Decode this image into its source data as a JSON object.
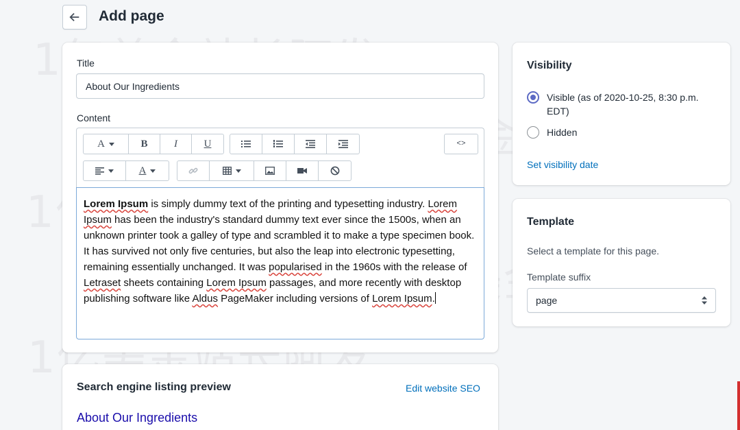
{
  "header": {
    "title": "Add page"
  },
  "main": {
    "title_label": "Title",
    "title_value": "About Our Ingredients",
    "content_label": "Content",
    "toolbar": {
      "font_btn": "A",
      "bold": "B",
      "italic": "I",
      "underline": "U",
      "html_btn": "<>",
      "color_btn": "A"
    },
    "editor": {
      "seg1_bold": "Lorem Ipsum",
      "seg2": " is simply dummy text of the printing and typesetting industry. ",
      "seg3": "Lorem Ipsum",
      "seg4": " has been the industry's standard dummy text ever since the 1500s, when an unknown printer took a galley of type and scrambled it to make a type specimen book. It has survived not only five centuries, but also the leap into electronic typesetting, remaining essentially unchanged. It was ",
      "seg5": "popularised",
      "seg6": " in the 1960s with the release of ",
      "seg7": "Letraset",
      "seg8": " sheets containing ",
      "seg9": "Lorem Ipsum",
      "seg10": " passages, and more recently with desktop publishing software like ",
      "seg11": "Aldus",
      "seg12": " PageMaker including versions of ",
      "seg13": "Lorem Ipsum",
      "seg14": "."
    }
  },
  "seo": {
    "heading": "Search engine listing preview",
    "edit_link": "Edit website SEO",
    "preview_title": "About Our Ingredients"
  },
  "visibility": {
    "heading": "Visibility",
    "visible_label": "Visible (as of 2020-10-25, 8:30 p.m. EDT)",
    "hidden_label": "Hidden",
    "set_date_link": "Set visibility date",
    "selected": "visible"
  },
  "template": {
    "heading": "Template",
    "description": "Select a template for this page.",
    "suffix_label": "Template suffix",
    "suffix_value": "page"
  },
  "watermark": {
    "text": "1亿美金站长阿发"
  },
  "colors": {
    "accent": "#5c6ac4",
    "link": "#006fbb",
    "focus_border": "#7ba9d9"
  }
}
